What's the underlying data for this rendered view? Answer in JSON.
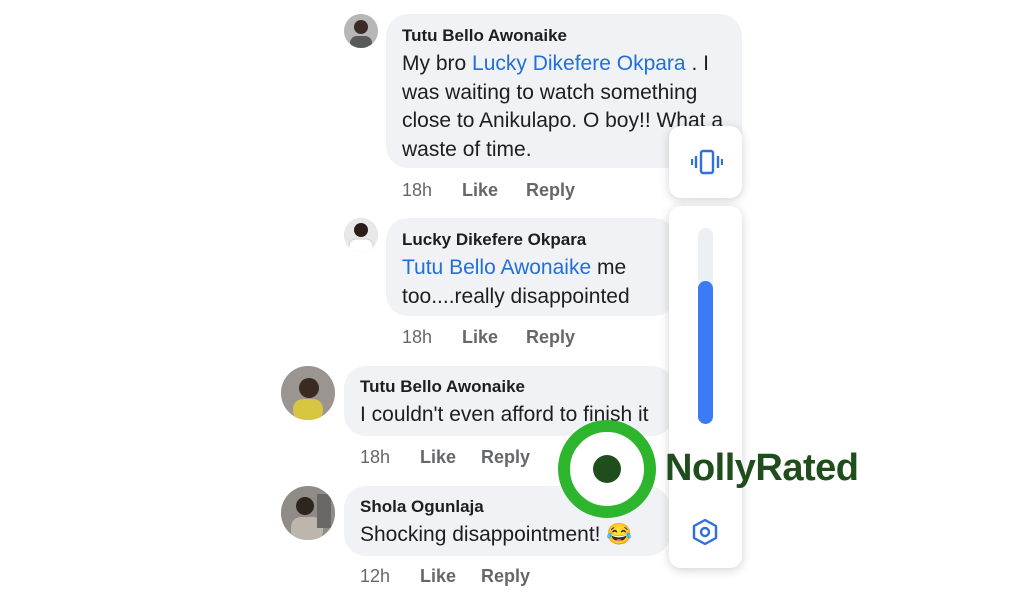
{
  "comments": [
    {
      "author": "Tutu Bello Awonaike",
      "text_prefix": "My bro ",
      "mention": "Lucky Dikefere Okpara",
      "text_suffix": " . I was waiting to watch something close to Anikulapo. O boy!! What a waste of time.",
      "time": "18h",
      "like": "Like",
      "reply": "Reply"
    },
    {
      "author": "Lucky Dikefere Okpara",
      "text_prefix": "",
      "mention": "Tutu Bello Awonaike",
      "text_suffix": " me too....really disappointed",
      "time": "18h",
      "like": "Like",
      "reply": "Reply"
    },
    {
      "author": "Tutu Bello Awonaike",
      "text_prefix": "I couldn't even afford to finish it",
      "mention": "",
      "text_suffix": "",
      "time": "18h",
      "like": "Like",
      "reply": "Reply"
    },
    {
      "author": "Shola Ogunlaja",
      "text_prefix": "Shocking disappointment! ",
      "mention": "",
      "text_suffix": "",
      "emoji": "😂",
      "time": "12h",
      "like": "Like",
      "reply": "Reply"
    }
  ],
  "volume_panel": {
    "mode_icon": "vibrate-icon",
    "level": 0.73,
    "settings_icon": "settings-hexagon-icon"
  },
  "watermark": {
    "logo_icon": "record-circle-icon",
    "text": "NollyRated",
    "colors": {
      "ring": "#2db52d",
      "dot": "#1f4d1c",
      "text": "#1f4d1c"
    }
  },
  "colors": {
    "mention": "#216fdb",
    "bubble": "#f0f2f5",
    "slider": "#3b7bf6"
  }
}
